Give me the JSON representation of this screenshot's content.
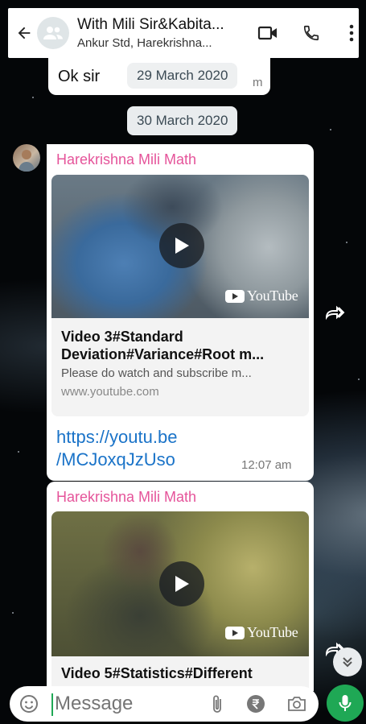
{
  "header": {
    "title": "With Mili Sir&Kabita...",
    "subtitle": "Ankur Std, Harekrishna...",
    "icons": [
      "back-arrow-icon",
      "group-avatar-icon",
      "video-call-icon",
      "voice-call-icon",
      "more-options-icon"
    ]
  },
  "messages": {
    "first": {
      "text": "Ok sir",
      "date_overlay": "29 March 2020",
      "time_fragment": "m"
    },
    "date_separator": "30 March 2020",
    "link_msg_1": {
      "sender": "Harekrishna Mili Math",
      "youtube_label": "YouTube",
      "preview_title_line1": "Video 3#Standard",
      "preview_title_line2": "Deviation#Variance#Root m...",
      "preview_description": "Please do watch and subscribe m...",
      "preview_domain": "www.youtube.com",
      "link_line1": "https://youtu.be",
      "link_line2": "/MCJoxqJzUso",
      "time": "12:07 am"
    },
    "link_msg_2": {
      "sender": "Harekrishna Mili Math",
      "youtube_label": "YouTube",
      "preview_title_line1": "Video 5#Statistics#Different"
    }
  },
  "input": {
    "placeholder": "Message",
    "icons": [
      "emoji-icon",
      "attach-icon",
      "rupee-payment-icon",
      "camera-icon",
      "mic-icon"
    ]
  },
  "colors": {
    "sender_name": "#e5549a",
    "link": "#1a73c8",
    "mic_button": "#1fa855",
    "bubble": "#ffffff"
  }
}
